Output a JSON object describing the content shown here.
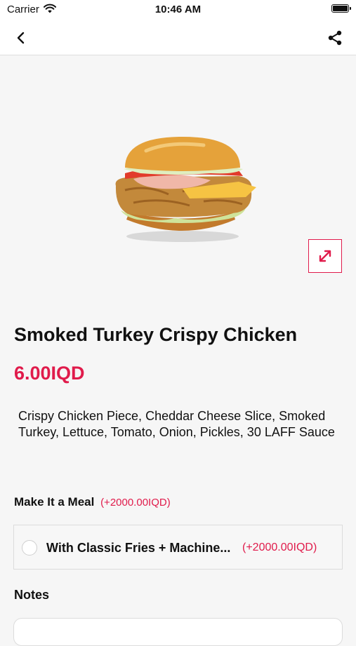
{
  "status_bar": {
    "carrier": "Carrier",
    "time": "10:46 AM"
  },
  "nav": {
    "back_icon": "chevron-left-icon",
    "share_icon": "share-icon"
  },
  "product": {
    "image": "crispy-chicken-burger-photo",
    "expand_icon": "expand-arrows-icon",
    "name": "Smoked Turkey Crispy Chicken",
    "price": "6.00IQD",
    "description": "Crispy Chicken Piece, Cheddar Cheese Slice, Smoked Turkey, Lettuce, Tomato, Onion, Pickles, 30 LAFF Sauce"
  },
  "meal_section": {
    "title": "Make It a Meal",
    "extra_price": "(+2000.00IQD)",
    "options": [
      {
        "label": "With Classic Fries + Machine...",
        "price": "(+2000.00IQD)",
        "selected": false
      }
    ]
  },
  "notes": {
    "title": "Notes"
  },
  "colors": {
    "accent": "#e01b4b",
    "background": "#f6f6f6"
  }
}
